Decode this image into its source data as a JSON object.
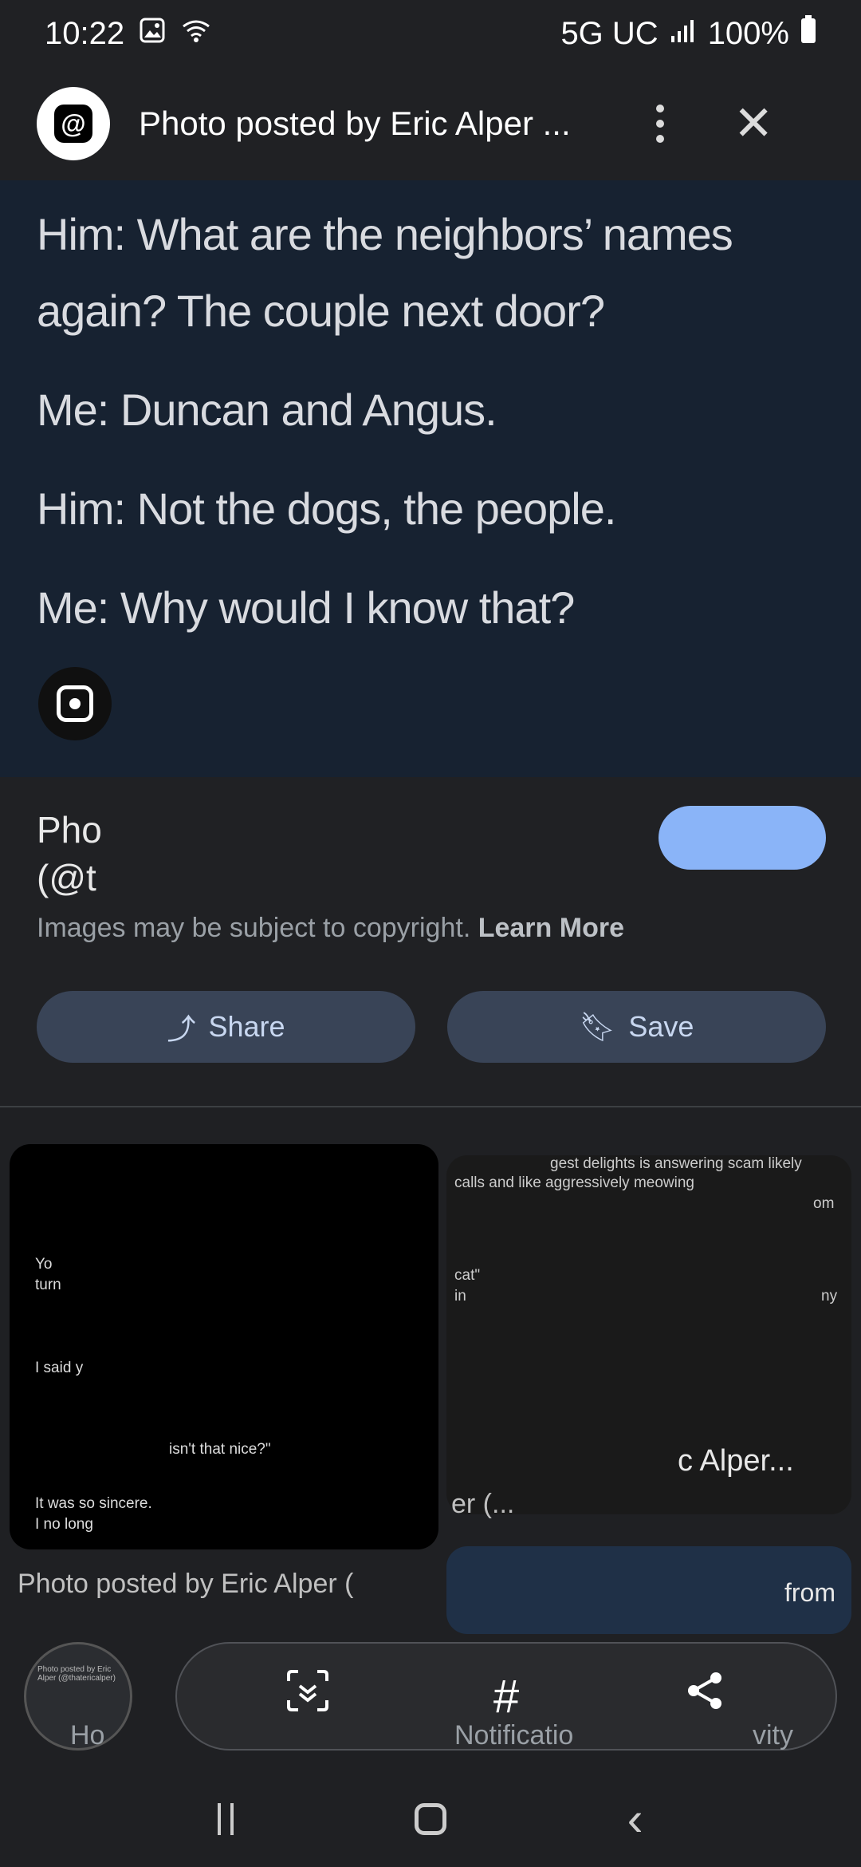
{
  "status_bar": {
    "time": "10:22",
    "network": "5G UC",
    "battery": "100%"
  },
  "header": {
    "app_icon": "threads-icon",
    "title": "Photo posted by Eric Alper ..."
  },
  "image": {
    "lines": [
      "Him: What are the neighbors’ names again? The couple next door?",
      "Me: Duncan and Angus.",
      "Him: Not the dogs, the people.",
      "Me: Why would I know that?"
    ]
  },
  "info": {
    "title_line1": "Pho",
    "title_line2": "(@t",
    "copyright_text": "Images may be subject to copyright.",
    "learn_more": "Learn More",
    "share_label": "Share",
    "save_label": "Save"
  },
  "related": {
    "left_card_lines": [
      "Yo",
      "turn",
      "I said y",
      "isn't that nice?\"",
      "It was so sincere.",
      "I no long"
    ],
    "right_card_lines": [
      "gest delights is answering scam likely",
      "calls and like aggressively meowing",
      "om",
      "cat\"",
      "in",
      "ny"
    ],
    "right_caption_1": "c Alper...",
    "right_caption_2": "er (...",
    "left_caption": "Photo posted by Eric Alper (",
    "right_strip_text": "from",
    "thumb_text": "Photo posted by Eric Alper (@thatericalper)"
  },
  "bottom_toolbar": {
    "items": [
      "scan-icon",
      "hashtag-icon",
      "share-icon"
    ]
  },
  "tab_labels": {
    "home": "Ho",
    "notifications": "Notificatio",
    "activity": "vity"
  }
}
